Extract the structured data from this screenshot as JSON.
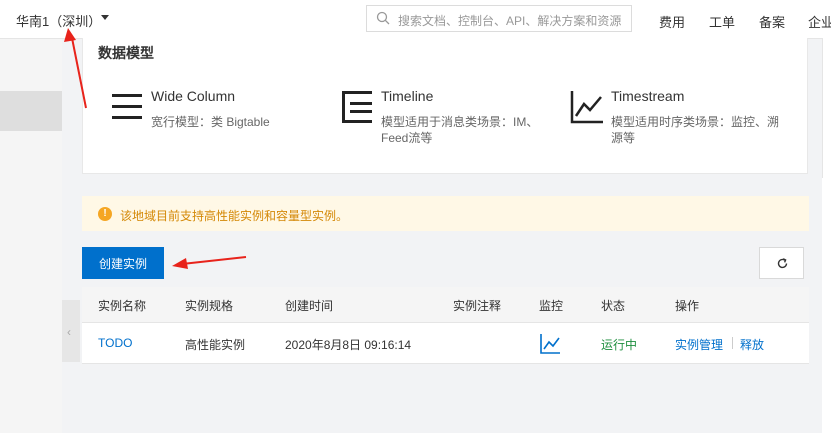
{
  "header": {
    "region": "华南1（深圳）",
    "search_placeholder": "搜索文档、控制台、API、解决方案和资源",
    "nav": [
      "费用",
      "工单",
      "备案",
      "企业"
    ]
  },
  "models": {
    "title": "数据模型",
    "items": [
      {
        "name": "Wide Column",
        "desc": "宽行模型：类 Bigtable",
        "icon": "wide-column-icon"
      },
      {
        "name": "Timeline",
        "desc_line1": "模型适用于消息类场景：IM、",
        "desc_line2": "Feed流等",
        "icon": "timeline-icon"
      },
      {
        "name": "Timestream",
        "desc_line1": "模型适用时序类场景：监控、溯",
        "desc_line2": "源等",
        "icon": "timestream-icon"
      }
    ]
  },
  "notice": {
    "text": "该地域目前支持高性能实例和容量型实例。",
    "icon": "warning-icon"
  },
  "toolbar": {
    "create_label": "创建实例",
    "refresh_icon": "refresh-icon"
  },
  "table": {
    "columns": [
      "实例名称",
      "实例规格",
      "创建时间",
      "实例注释",
      "监控",
      "状态",
      "操作"
    ],
    "rows": [
      {
        "name": "TODO",
        "spec": "高性能实例",
        "created": "2020年8月8日 09:16:14",
        "comment": "",
        "monitor_icon": "chart-icon",
        "status": "运行中",
        "action_manage": "实例管理",
        "action_release": "释放"
      }
    ]
  },
  "colors": {
    "primary": "#0070cc",
    "annotation": "#e8231b",
    "running": "#1e8e3e",
    "warning": "#f5a623"
  }
}
